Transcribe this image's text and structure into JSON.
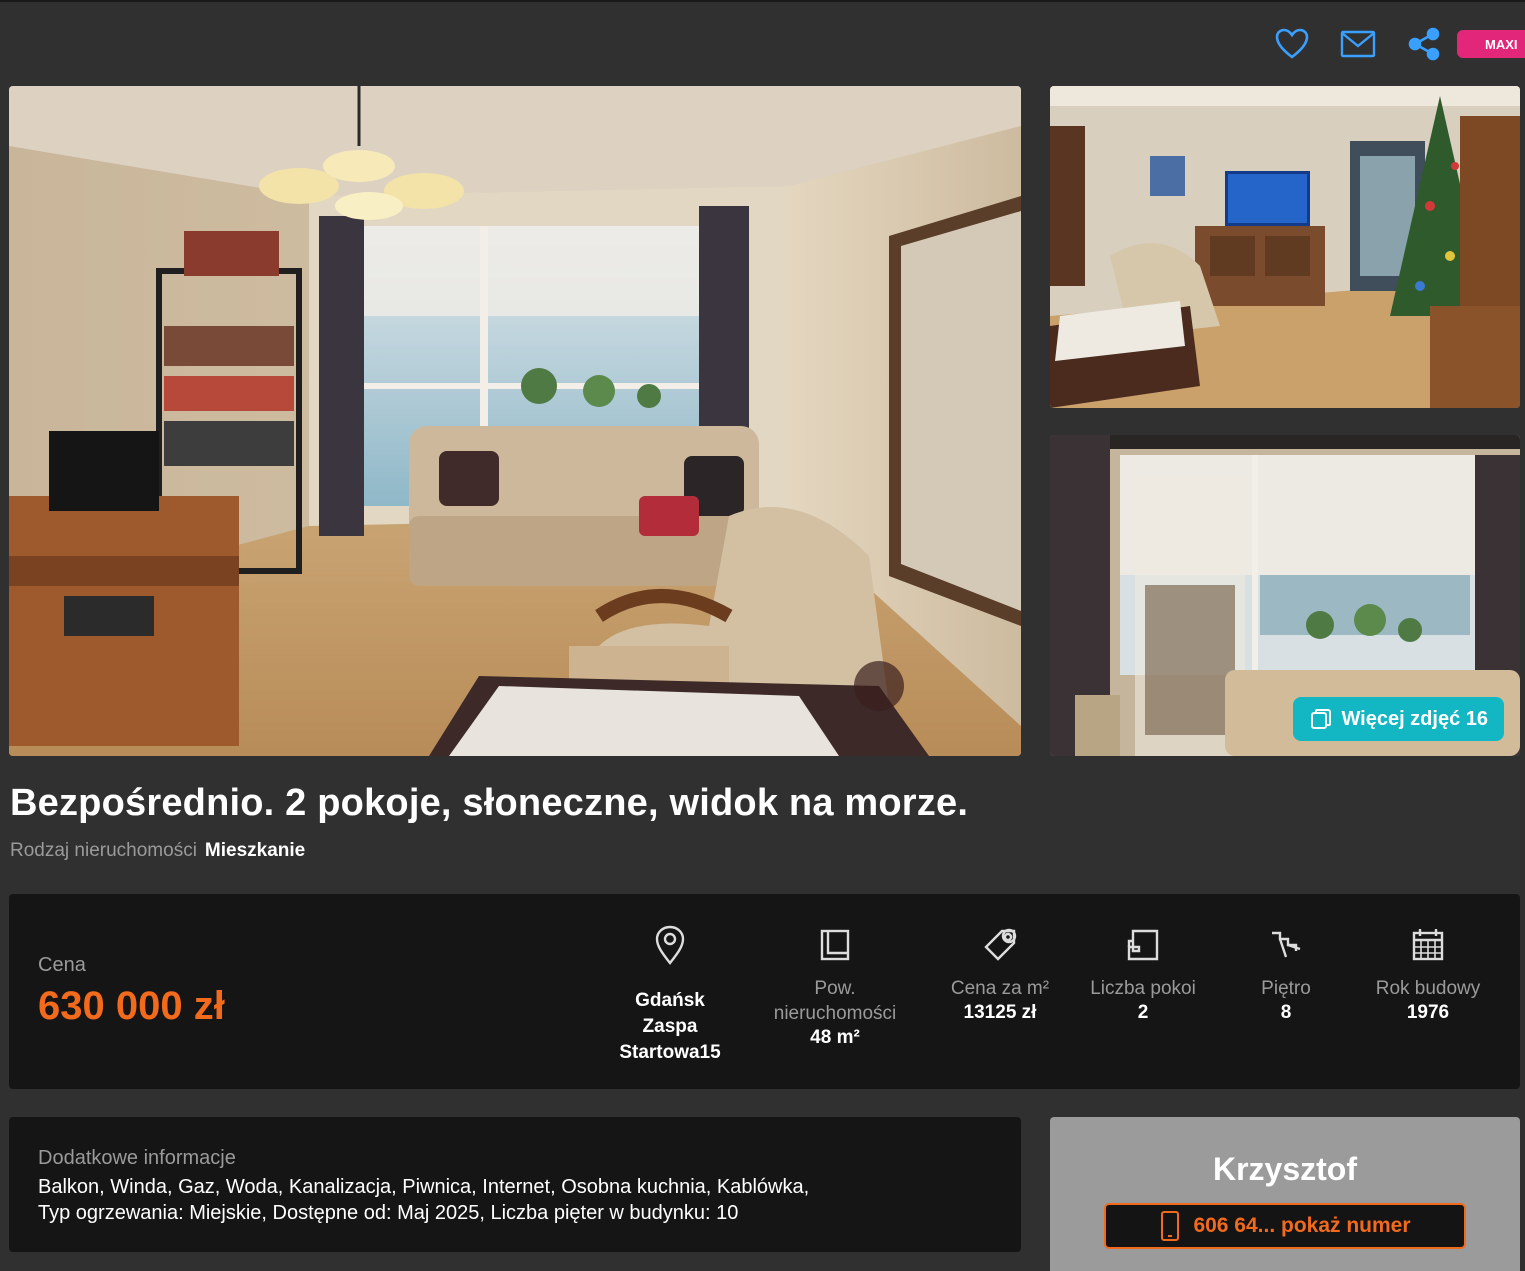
{
  "top_actions": {
    "favorite_icon": "heart-icon",
    "message_icon": "envelope-icon",
    "share_icon": "share-icon",
    "badge": "MAXI"
  },
  "gallery": {
    "more_photos_label": "Więcej zdjęć 16"
  },
  "listing": {
    "title": "Bezpośrednio. 2 pokoje, słoneczne, widok na morze.",
    "property_type_label": "Rodzaj nieruchomości",
    "property_type_value": "Mieszkanie"
  },
  "summary": {
    "price_label": "Cena",
    "price_value": "630 000 zł",
    "location": {
      "city": "Gdańsk",
      "district": "Zaspa",
      "street": "Startowa15"
    },
    "stats": [
      {
        "label": "Pow. nieruchomości",
        "value": "48 m²",
        "icon": "area-icon"
      },
      {
        "label": "Cena za m²",
        "value": "13125 zł",
        "icon": "price-tag-icon"
      },
      {
        "label": "Liczba pokoi",
        "value": "2",
        "icon": "rooms-icon"
      },
      {
        "label": "Piętro",
        "value": "8",
        "icon": "stairs-icon"
      },
      {
        "label": "Rok budowy",
        "value": "1976",
        "icon": "calendar-icon"
      }
    ]
  },
  "extra": {
    "title": "Dodatkowe informacje",
    "line1": "Balkon,  Winda,  Gaz,  Woda,  Kanalizacja,  Piwnica,  Internet,  Osobna kuchnia,  Kablówka,",
    "line2": "Typ ogrzewania: Miejskie,  Dostępne od: Maj 2025,  Liczba pięter w budynku: 10"
  },
  "contact": {
    "name": "Krzysztof",
    "phone_label": "606 64... pokaż numer"
  },
  "colors": {
    "accent": "#f26a1c",
    "teal": "#12b7c3",
    "badge": "#e2267a",
    "background": "#303030",
    "panel": "#151515"
  }
}
